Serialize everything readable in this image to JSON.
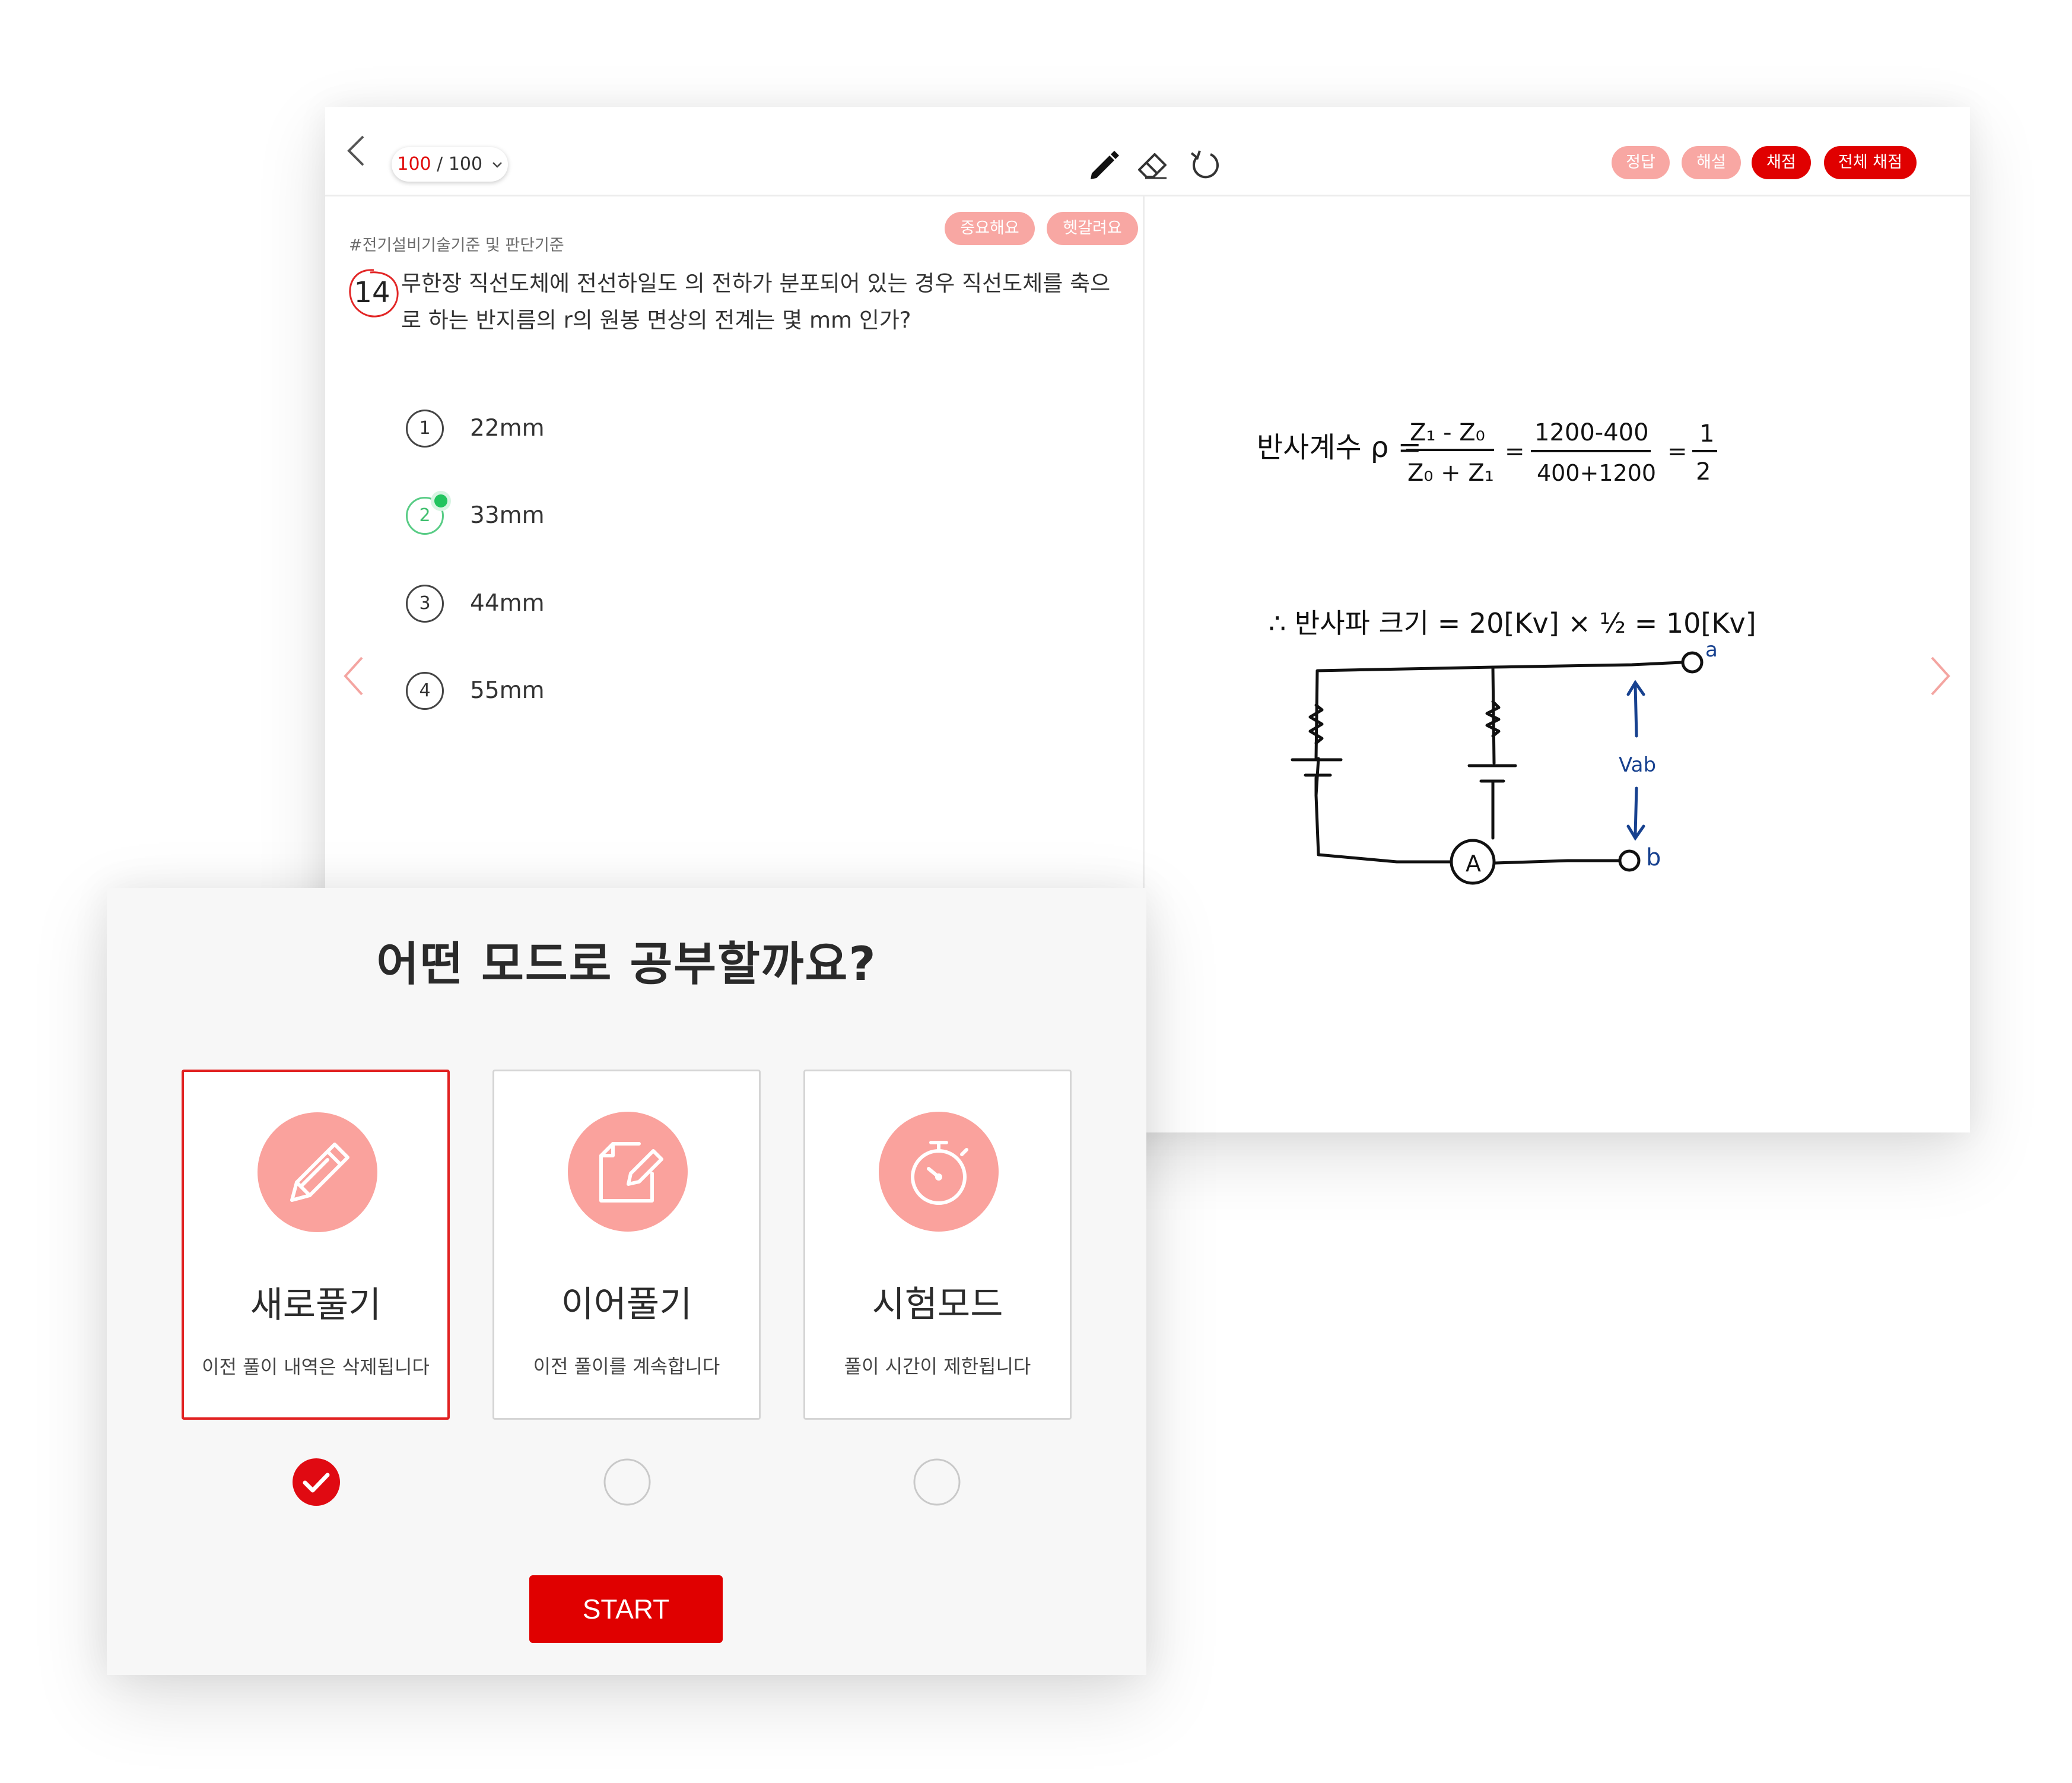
{
  "quiz": {
    "page_current": "100",
    "page_total": "/ 100",
    "header_buttons": {
      "answer": "정답",
      "explanation": "해설",
      "grade": "채점",
      "grade_all": "전체 채점"
    },
    "tag": "#전기설비기술기준 및 판단기준",
    "tag_buttons": {
      "important": "중요해요",
      "confusing": "헷갈려요"
    },
    "question": {
      "number": "14",
      "line1": "무한장 직선도체에 전선하일도 의 전하가 분포되어 있는 경우 직선도체를 축으",
      "line2": "로 하는 반지름의 r의 원봉 면상의 전계는 몇 mm 인가?"
    },
    "choices": [
      {
        "num": "1",
        "label": "22mm",
        "selected": false
      },
      {
        "num": "2",
        "label": "33mm",
        "selected": true
      },
      {
        "num": "3",
        "label": "44mm",
        "selected": false
      },
      {
        "num": "4",
        "label": "55mm",
        "selected": false
      }
    ],
    "notes": {
      "eq1_prefix": "반사계수 ρ =",
      "eq1_frac1_num": "Z₁ - Z₀",
      "eq1_frac1_den": "Z₀ + Z₁",
      "eq1_frac2_num": "1200-400",
      "eq1_frac2_den": "400+1200",
      "eq1_result_num": "1",
      "eq1_result_den": "2",
      "eq2": "∴ 반사파 크기 = 20[Kv] × ½ = 10[Kv]",
      "label_a": "a",
      "label_b": "b",
      "label_vab": "Vab",
      "label_ammeter": "A"
    }
  },
  "mode_select": {
    "title": "어떤 모드로 공부할까요?",
    "modes": [
      {
        "name": "새로풀기",
        "desc": "이전 풀이 내역은 삭제됩니다",
        "icon": "pencil-icon",
        "selected": true
      },
      {
        "name": "이어풀기",
        "desc": "이전 풀이를 계속합니다",
        "icon": "edit-note-icon",
        "selected": false
      },
      {
        "name": "시험모드",
        "desc": "풀이 시간이 제한됩니다",
        "icon": "stopwatch-icon",
        "selected": false
      }
    ],
    "start_label": "START"
  },
  "colors": {
    "accent": "#e00000",
    "accent_light": "#f8a7a3",
    "selected_choice": "#21c45e",
    "icon_circle": "#faa29d",
    "ink_blue": "#17418f"
  }
}
